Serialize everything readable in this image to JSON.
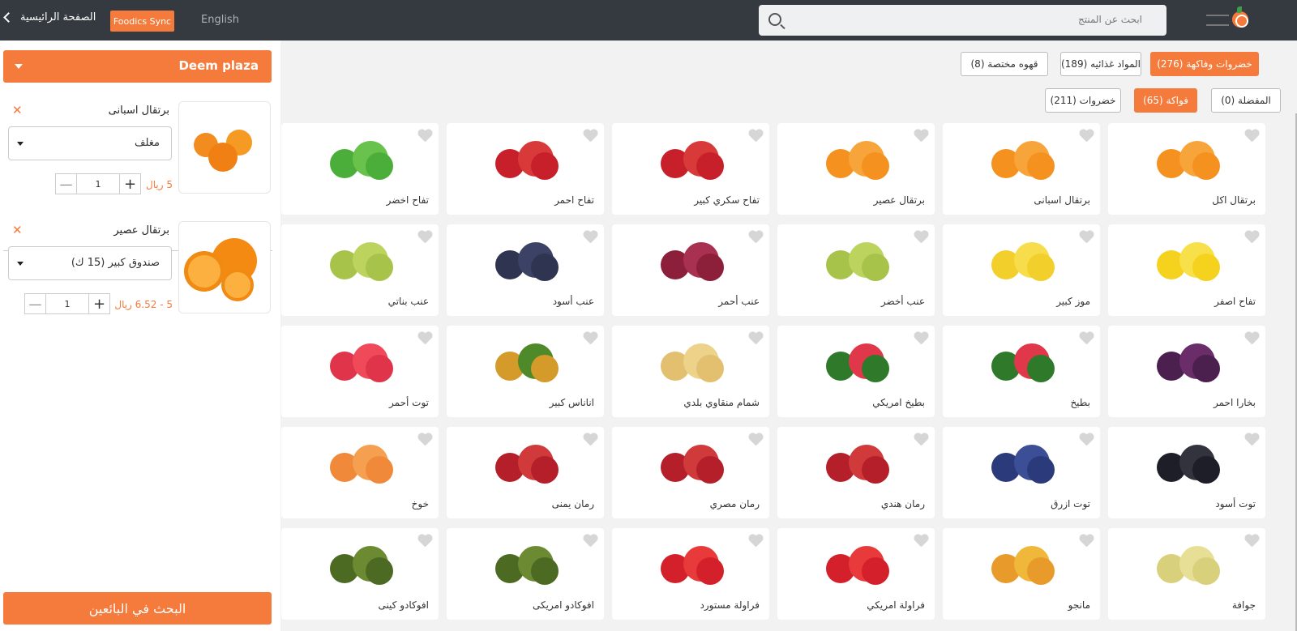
{
  "topbar": {
    "back_label": "الصفحة الرائيسية",
    "sync_label": "Foodics Sync",
    "lang_label": "English",
    "search_placeholder": "ابحث عن المنتج"
  },
  "sidebar": {
    "branch": "Deem plaza",
    "cart": [
      {
        "name": "برتقال اسبانى",
        "variant": "مغلف",
        "qty": "1",
        "price": "5 ريال"
      },
      {
        "name": "برتقال عصير",
        "variant": "صندوق كبير (15 ك)",
        "qty": "1",
        "price": "5 - 6.52 ريال"
      }
    ],
    "search_vendors": "البحث في البائعين"
  },
  "categories": [
    {
      "label": "خضروات وفاكهة (276)",
      "active": true
    },
    {
      "label": "المواد غذائيه (189)",
      "active": false
    },
    {
      "label": "قهوه مختصة (8)",
      "active": false
    }
  ],
  "subcategories": [
    {
      "label": "المفضلة (0)",
      "active": false
    },
    {
      "label": "فواكة (65)",
      "active": true
    },
    {
      "label": "خضروات (211)",
      "active": false
    }
  ],
  "products": [
    {
      "name": "برتقال اكل",
      "icon": "orange"
    },
    {
      "name": "برتقال اسبانى",
      "icon": "orange"
    },
    {
      "name": "برتقال عصير",
      "icon": "orange"
    },
    {
      "name": "تفاح سكري كبير",
      "icon": "apple-red"
    },
    {
      "name": "تفاح احمر",
      "icon": "apple-red"
    },
    {
      "name": "تفاح اخضر",
      "icon": "apple-green"
    },
    {
      "name": "تفاح اصفر",
      "icon": "apple-yellow"
    },
    {
      "name": "موز كبير",
      "icon": "banana"
    },
    {
      "name": "عنب أخضر",
      "icon": "grape-green"
    },
    {
      "name": "عنب أحمر",
      "icon": "grape-red"
    },
    {
      "name": "عنب أسود",
      "icon": "grape-black"
    },
    {
      "name": "عنب بناتي",
      "icon": "grape-green"
    },
    {
      "name": "بخارا احمر",
      "icon": "plum"
    },
    {
      "name": "بطيخ",
      "icon": "watermelon"
    },
    {
      "name": "بطيخ امريكي",
      "icon": "watermelon"
    },
    {
      "name": "شمام منقاوي بلدي",
      "icon": "melon"
    },
    {
      "name": "اناناس كبير",
      "icon": "pineapple"
    },
    {
      "name": "توت أحمر",
      "icon": "raspberry"
    },
    {
      "name": "توت أسود",
      "icon": "blackberry"
    },
    {
      "name": "توت ازرق",
      "icon": "blueberry"
    },
    {
      "name": "رمان هندي",
      "icon": "pomegranate"
    },
    {
      "name": "رمان مصري",
      "icon": "pomegranate"
    },
    {
      "name": "رمان يمنى",
      "icon": "pomegranate"
    },
    {
      "name": "خوخ",
      "icon": "peach"
    },
    {
      "name": "جوافة",
      "icon": "guava"
    },
    {
      "name": "مانجو",
      "icon": "mango"
    },
    {
      "name": "فراولة امريكي",
      "icon": "strawberry"
    },
    {
      "name": "فراولة مستورد",
      "icon": "strawberry"
    },
    {
      "name": "افوكادو امريكى",
      "icon": "avocado"
    },
    {
      "name": "افوكادو كينى",
      "icon": "avocado"
    }
  ],
  "colors": {
    "accent": "#f47b3b",
    "topbar": "#343a40"
  }
}
